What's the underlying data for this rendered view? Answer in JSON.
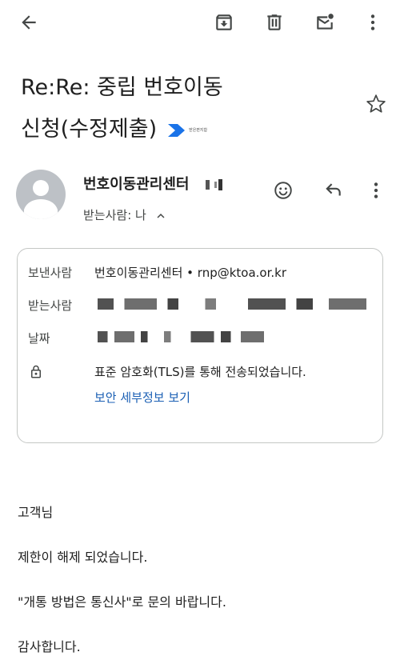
{
  "toolbar": {
    "back": "arrow-back-icon",
    "archive": "archive-icon",
    "delete": "trash-icon",
    "mark_unread": "mail-unread-icon",
    "more": "more-vert-icon"
  },
  "subject": {
    "line1": "Re:Re: 중립 번호이동",
    "line2": "신청(수정제출)",
    "label_text": "받은편지함"
  },
  "sender": {
    "name": "번호이동관리센터",
    "recipient_summary": "받는사람: 나"
  },
  "details": {
    "from_label": "보낸사람",
    "from_value": "번호이동관리센터 • rnp@ktoa.or.kr",
    "to_label": "받는사람",
    "date_label": "날짜",
    "security_text": "표준 암호화(TLS)를 통해 전송되었습니다.",
    "security_link": "보안 세부정보 보기"
  },
  "body": {
    "greeting": "고객님",
    "line1": "제한이 해제 되었습니다.",
    "line2": "\"개통 방법은 통신사\"로 문의 바랍니다.",
    "closing": "감사합니다."
  },
  "colors": {
    "accent": "#1a5fb4",
    "label_arrow": "#1a73e8",
    "icon": "#444746"
  }
}
